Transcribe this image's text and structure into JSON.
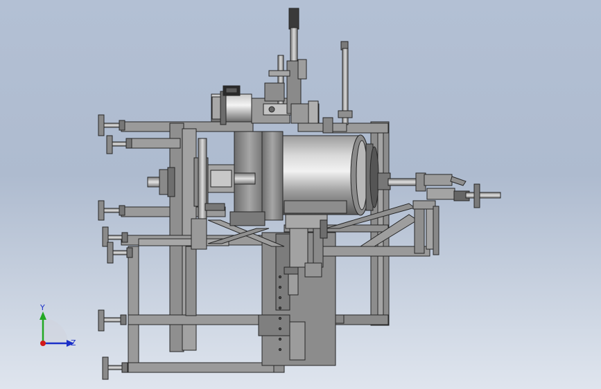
{
  "triad": {
    "y_label": "Y",
    "z_label": "Z",
    "colors": {
      "y": "#22a822",
      "z": "#1a2fc8",
      "x": "#d21a1a"
    }
  },
  "colors": {
    "metal": "#8e8e8e",
    "metal_light": "#a9a9a9",
    "metal_dark": "#555555",
    "outline": "#262626"
  }
}
